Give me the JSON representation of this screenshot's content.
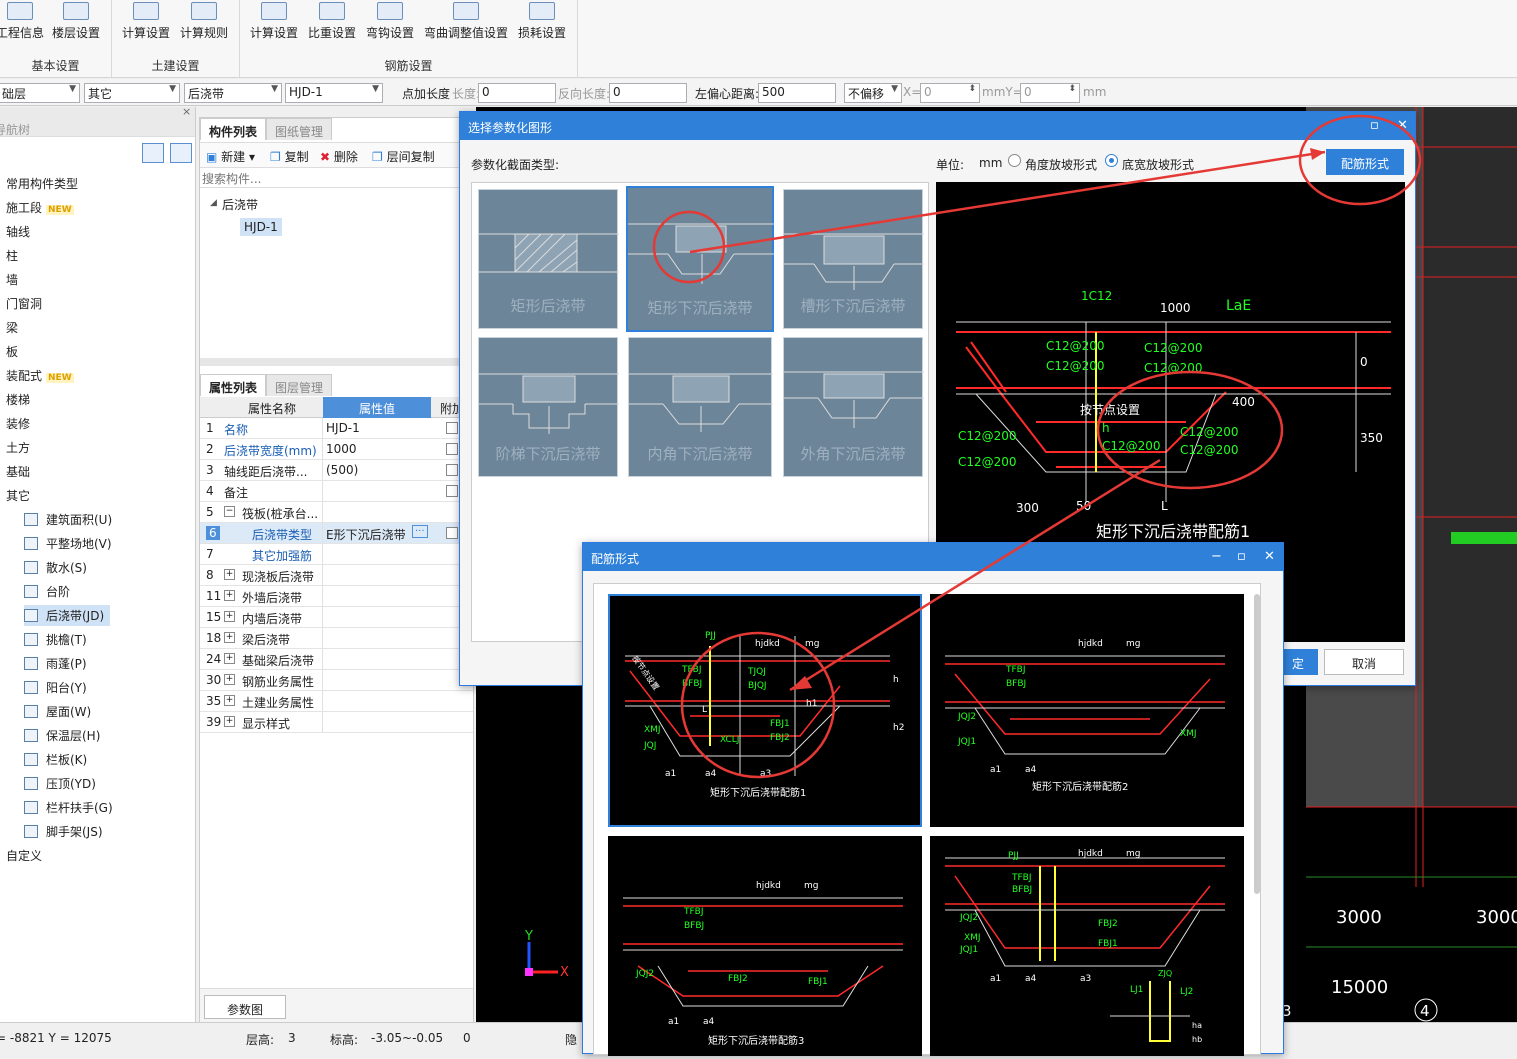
{
  "ribbon": {
    "groups": [
      {
        "label": "基本设置",
        "buttons": [
          "工程信息",
          "楼层设置"
        ]
      },
      {
        "label": "土建设置",
        "buttons": [
          "计算设置",
          "计算规则"
        ]
      },
      {
        "label": "钢筋设置",
        "buttons": [
          "计算设置",
          "比重设置",
          "弯钩设置",
          "弯曲调整值设置",
          "损耗设置"
        ]
      }
    ]
  },
  "toolbar": {
    "floor": "础层",
    "category": "其它",
    "type": "后浇带",
    "component": "HJD-1",
    "point_length_label": "点加长度",
    "length_label": "长度:",
    "length_value": "0",
    "reverse_label": "反向长度:",
    "reverse_value": "0",
    "offset_label": "左偏心距离:",
    "offset_value": "500",
    "shift": "不偏移",
    "x_label": "X=",
    "x_value": "0",
    "mmy_label": "mmY=",
    "y_value": "0",
    "mm": "mm"
  },
  "nav": {
    "title": "导航树",
    "items": [
      "常用构件类型",
      "施工段",
      "轴线",
      "柱",
      "墙",
      "门窗洞",
      "梁",
      "板",
      "装配式",
      "楼梯",
      "装修",
      "土方",
      "基础",
      "其它"
    ],
    "new_badge": "NEW",
    "sub_items": [
      "建筑面积(U)",
      "平整场地(V)",
      "散水(S)",
      "台阶",
      "后浇带(JD)",
      "挑檐(T)",
      "雨蓬(P)",
      "阳台(Y)",
      "屋面(W)",
      "保温层(H)",
      "栏板(K)",
      "压顶(YD)",
      "栏杆扶手(G)",
      "脚手架(JS)"
    ],
    "last": "自定义"
  },
  "comp_list": {
    "tabs": [
      "构件列表",
      "图纸管理"
    ],
    "actions": [
      "新建",
      "复制",
      "删除",
      "层间复制"
    ],
    "search_placeholder": "搜索构件...",
    "tree_root": "后浇带",
    "tree_child": "HJD-1"
  },
  "prop_list": {
    "tabs": [
      "属性列表",
      "图层管理"
    ],
    "headers": [
      "属性名称",
      "属性值",
      "附加"
    ],
    "rows": [
      {
        "no": "1",
        "name": "名称",
        "value": "HJD-1",
        "blue": true
      },
      {
        "no": "2",
        "name": "后浇带宽度(mm)",
        "value": "1000",
        "blue": true
      },
      {
        "no": "3",
        "name": "轴线距后浇带...",
        "value": "(500)",
        "blue": false
      },
      {
        "no": "4",
        "name": "备注",
        "value": "",
        "blue": false
      },
      {
        "no": "5",
        "name": "筏板(桩承台...",
        "value": "",
        "blue": false
      },
      {
        "no": "6",
        "name": "后浇带类型",
        "value": "E形下沉后浇带",
        "blue": true
      },
      {
        "no": "7",
        "name": "其它加强筋",
        "value": "",
        "blue": true
      },
      {
        "no": "8",
        "name": "现浇板后浇带",
        "value": "",
        "blue": false
      },
      {
        "no": "11",
        "name": "外墙后浇带",
        "value": "",
        "blue": false
      },
      {
        "no": "15",
        "name": "内墙后浇带",
        "value": "",
        "blue": false
      },
      {
        "no": "18",
        "name": "梁后浇带",
        "value": "",
        "blue": false
      },
      {
        "no": "24",
        "name": "基础梁后浇带",
        "value": "",
        "blue": false
      },
      {
        "no": "30",
        "name": "钢筋业务属性",
        "value": "",
        "blue": false
      },
      {
        "no": "35",
        "name": "土建业务属性",
        "value": "",
        "blue": false
      },
      {
        "no": "39",
        "name": "显示样式",
        "value": "",
        "blue": false
      }
    ],
    "param_button": "参数图"
  },
  "dialog1": {
    "title": "选择参数化图形",
    "type_label": "参数化截面类型:",
    "unit_label": "单位:",
    "unit": "mm",
    "radio1": "角度放坡形式",
    "radio2": "底宽放坡形式",
    "peijin_button": "配筋形式",
    "shapes": [
      "矩形后浇带",
      "矩形下沉后浇带",
      "槽形下沉后浇带",
      "阶梯下沉后浇带",
      "内角下沉后浇带",
      "外角下沉后浇带"
    ],
    "preview": {
      "labels": [
        "1C12",
        "1000",
        "LaE",
        "C12@200",
        "C12@200",
        "C12@200",
        "C12@200",
        "C12@200",
        "C12@200",
        "C12@200",
        "C12@200",
        "C12@200",
        "h",
        "0",
        "400",
        "350",
        "300",
        "50",
        "L",
        "按节点设置"
      ],
      "caption": "矩形下沉后浇带配筋1"
    },
    "ok": "定",
    "cancel": "取消"
  },
  "dialog2": {
    "title": "配筋形式",
    "cards": [
      "矩形下沉后浇带配筋1",
      "矩形下沉后浇带配筋2",
      "矩形下沉后浇带配筋3",
      ""
    ],
    "labels": [
      "PJJ",
      "hjdkd",
      "mg",
      "TFBJ",
      "BFBJ",
      "TJQJ",
      "BJQJ",
      "XMJ",
      "JQJ",
      "XCLJ",
      "FBJ1",
      "FBJ2",
      "a1",
      "a4",
      "a3",
      "h",
      "h1",
      "h2",
      "L",
      "JQJ2",
      "JQJ1",
      "ZJQ",
      "LJ1",
      "LJ2",
      "ha",
      "hb",
      "按节点设置"
    ]
  },
  "canvas": {
    "dims": [
      "3000",
      "3000",
      "15000"
    ],
    "axis": [
      "3",
      "4"
    ],
    "x_axis": "X",
    "y_axis": "Y"
  },
  "status": {
    "coords": "= -8821 Y = 12075",
    "floor_label": "层高:",
    "floor_value": "3",
    "elev_label": "标高:",
    "elev_value": "-3.05~-0.05",
    "zero": "0",
    "hidden": "隐"
  },
  "colors": {
    "accent": "#2f80d8",
    "annot": "#e53935",
    "rebar_red": "#ff2a2a",
    "rebar_green": "#22ff22",
    "label_yellow": "#ffff33"
  }
}
